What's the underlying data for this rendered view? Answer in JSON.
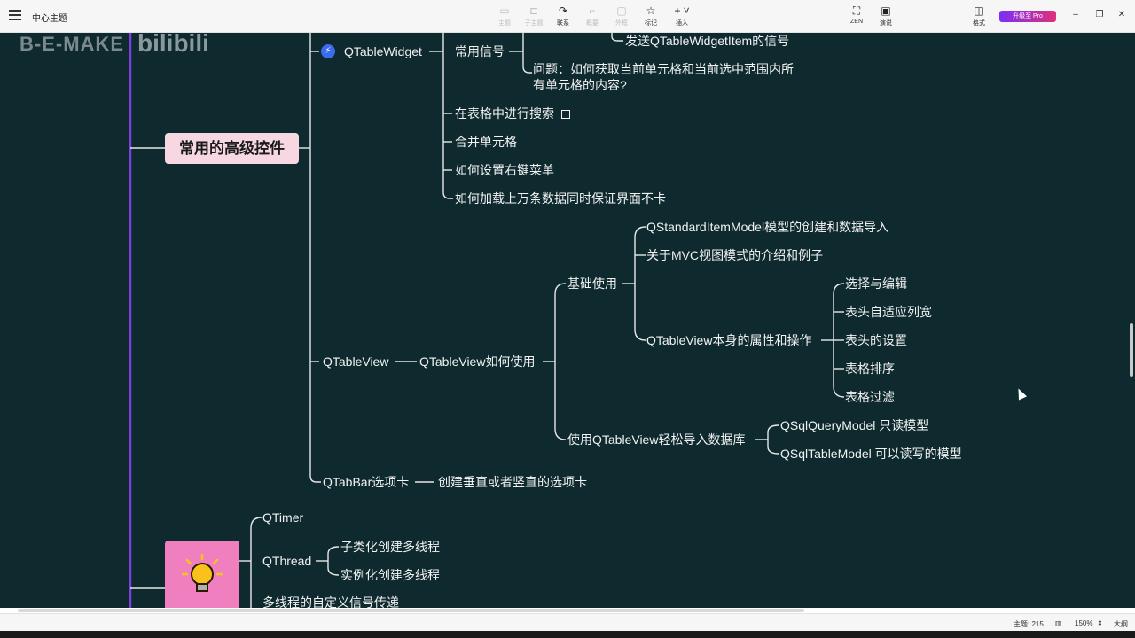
{
  "app": {
    "title": "中心主题"
  },
  "toolbar": {
    "items": [
      {
        "label": "主题",
        "icon": "topic-icon",
        "enabled": false
      },
      {
        "label": "子主题",
        "icon": "subtopic-icon",
        "enabled": false
      },
      {
        "label": "联系",
        "icon": "relationship-icon",
        "enabled": true
      },
      {
        "label": "概要",
        "icon": "summary-icon",
        "enabled": false
      },
      {
        "label": "外框",
        "icon": "boundary-icon",
        "enabled": false
      },
      {
        "label": "标记",
        "icon": "star-icon",
        "enabled": true
      },
      {
        "label": "插入",
        "icon": "plus-icon",
        "enabled": true
      }
    ],
    "zen_label": "ZEN",
    "present_label": "演说",
    "format_label": "格式",
    "pro_label": "升级至 Pro"
  },
  "map": {
    "watermark": "B-E-MAKE",
    "watermark_logo": "bilibili",
    "central_topic": "常用的高级控件",
    "nodes": {
      "qtablewidget": "QTableWidget",
      "common_signals": "常用信号",
      "send_item_signal": "发送QTableWidgetItem的信号",
      "question_line1": "问题：如何获取当前单元格和当前选中范围内所",
      "question_line2": "有单元格的内容?",
      "search_in_table": "在表格中进行搜索",
      "merge_cells": "合并单元格",
      "right_click_menu": "如何设置右键菜单",
      "load_data": "如何加载上万条数据同时保证界面不卡",
      "qtableview": "QTableView",
      "qtableview_howto": "QTableView如何使用",
      "basic_use": "基础使用",
      "model_create": "QStandardItemModel模型的创建和数据导入",
      "mvc_intro": "关于MVC视图模式的介绍和例子",
      "view_props": "QTableView本身的属性和操作",
      "select_edit": "选择与编辑",
      "header_fit": "表头自适应列宽",
      "header_settings": "表头的设置",
      "table_sort": "表格排序",
      "table_filter": "表格过滤",
      "import_db": "使用QTableView轻松导入数据库",
      "sql_query_model": "QSqlQueryModel 只读模型",
      "sql_table_model": "QSqlTableModel 可以读写的模型",
      "qtabbar": "QTabBar选项卡",
      "qtabbar_desc": "创建垂直或者竖直的选项卡",
      "qtimer": "QTimer",
      "qthread": "QThread",
      "subclass_thread": "子类化创建多线程",
      "instance_thread": "实例化创建多线程",
      "custom_signal": "多线程的自定义信号传递"
    }
  },
  "status": {
    "topics_label": "主题: 215",
    "zoom": "150%",
    "outline_label": "大纲"
  },
  "colors": {
    "canvas_bg": "#0e2a2f",
    "branch_line": "#e8e8e8",
    "main_line": "#7b3fe4",
    "central_fill": "#f6d7e2",
    "bulb_fill": "#ef7fbf",
    "bolt_fill": "#3b6cf0"
  }
}
